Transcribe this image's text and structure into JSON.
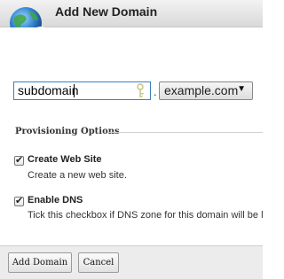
{
  "window": {
    "title": "Add New Domain"
  },
  "form": {
    "domain_input": {
      "value": "subdomain"
    },
    "separator": ".",
    "domain_select": {
      "selected": "example.com"
    }
  },
  "provisioning": {
    "heading": "Provisioning Options",
    "options": [
      {
        "label": "Create Web Site",
        "description": "Create a new web site.",
        "checked": true
      },
      {
        "label": "Enable DNS",
        "description": "Tick this checkbox if DNS zone for this domain will be l",
        "checked": true
      }
    ]
  },
  "footer": {
    "add_label": "Add Domain",
    "cancel_label": "Cancel"
  },
  "icons": {
    "globe": "globe-add-icon",
    "key": "key-icon",
    "checkmark": "✔",
    "dropdown": "▼"
  }
}
